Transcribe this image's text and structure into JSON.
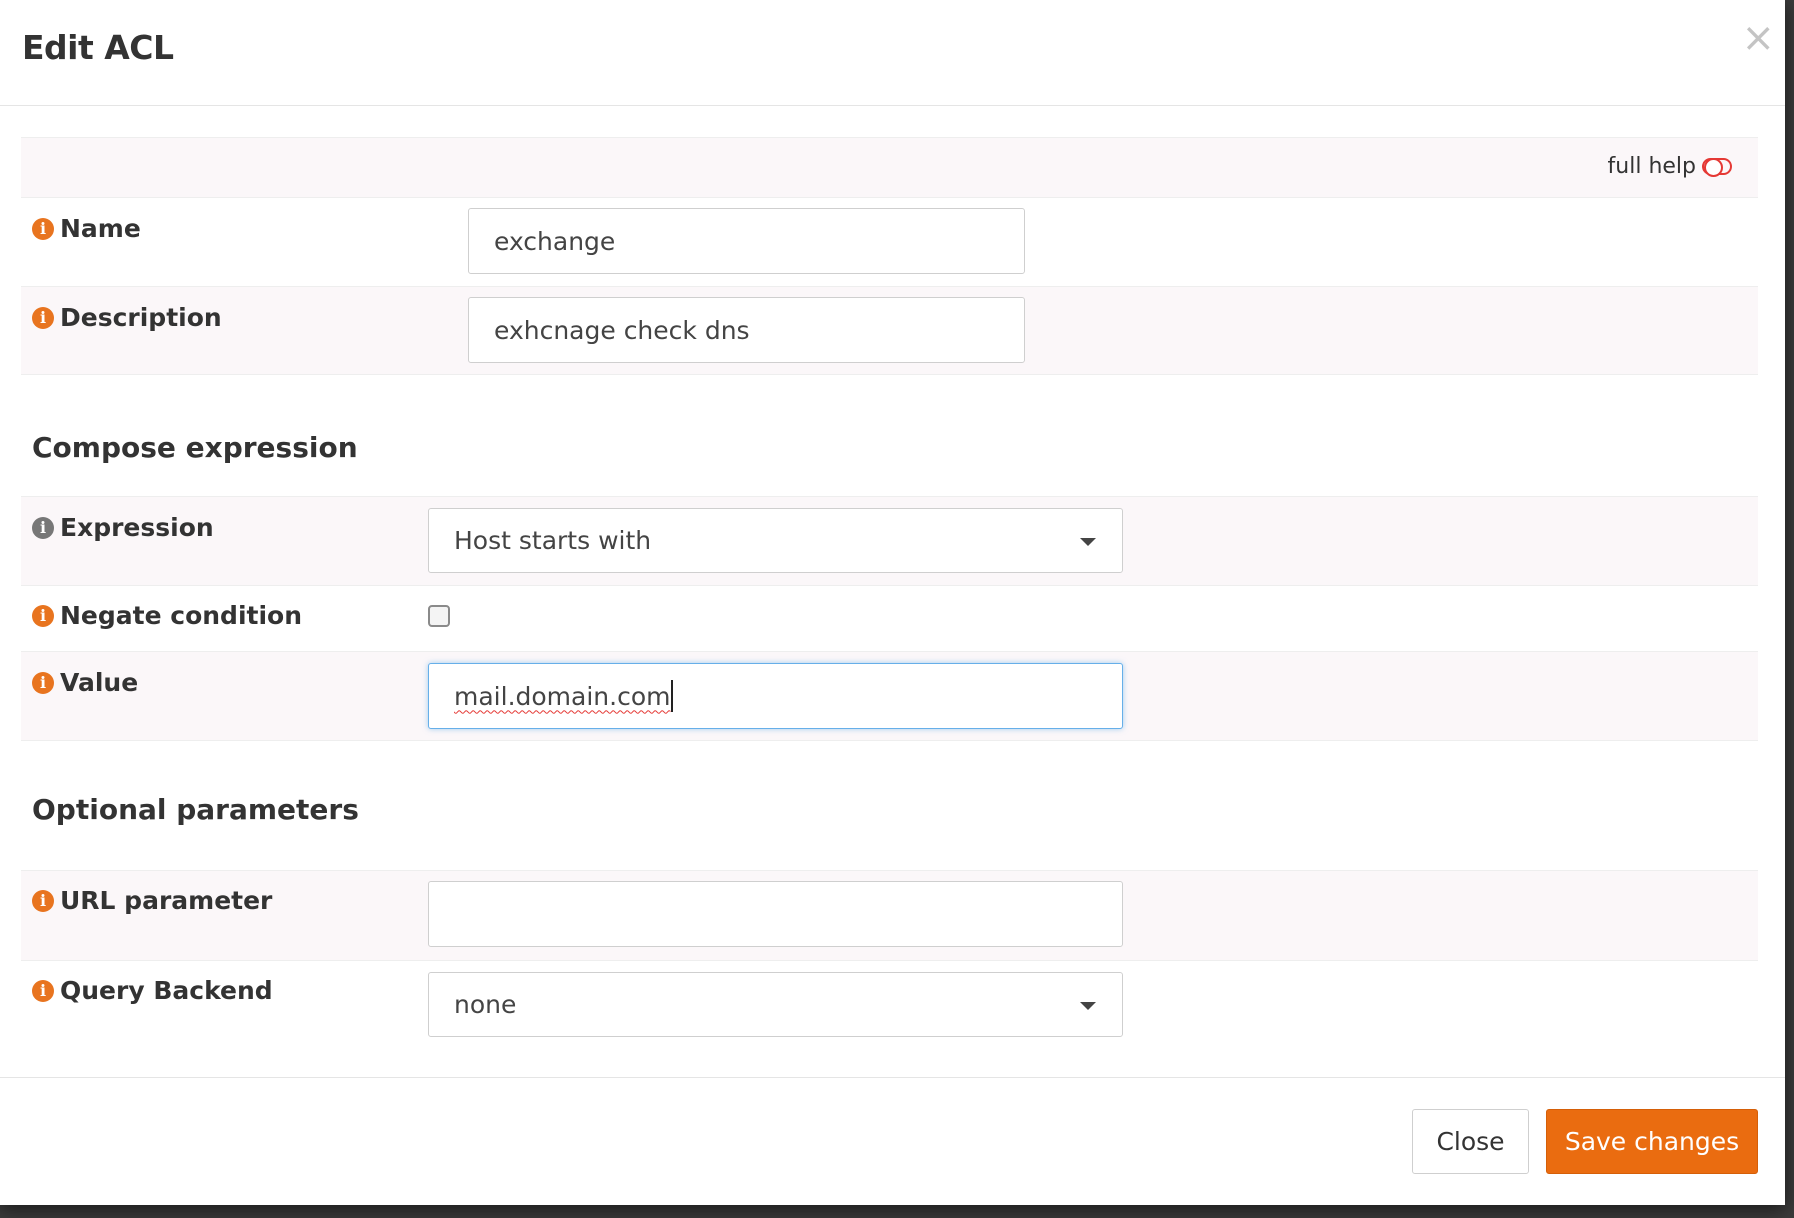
{
  "modal": {
    "title": "Edit ACL",
    "close_symbol": "×"
  },
  "help": {
    "label": "full help"
  },
  "fields": {
    "name": {
      "label": "Name",
      "value": "exchange"
    },
    "description": {
      "label": "Description",
      "value": "exhcnage check dns"
    }
  },
  "compose": {
    "title": "Compose expression",
    "expression": {
      "label": "Expression",
      "value": "Host starts with"
    },
    "negate": {
      "label": "Negate condition",
      "checked": false
    },
    "value": {
      "label": "Value",
      "value": "mail.domain.com"
    }
  },
  "optional": {
    "title": "Optional parameters",
    "url_parameter": {
      "label": "URL parameter",
      "value": ""
    },
    "query_backend": {
      "label": "Query Backend",
      "value": "none"
    }
  },
  "footer": {
    "close_label": "Close",
    "save_label": "Save changes"
  },
  "colors": {
    "accent": "#ea6c10",
    "info_icon": "#e8741f",
    "row_tint": "#fbf7f9",
    "focus": "#66afe9"
  },
  "icons": {
    "info": "info-icon",
    "close": "close-icon",
    "help_toggle": "toggle-icon",
    "dropdown": "chevron-down-icon"
  }
}
